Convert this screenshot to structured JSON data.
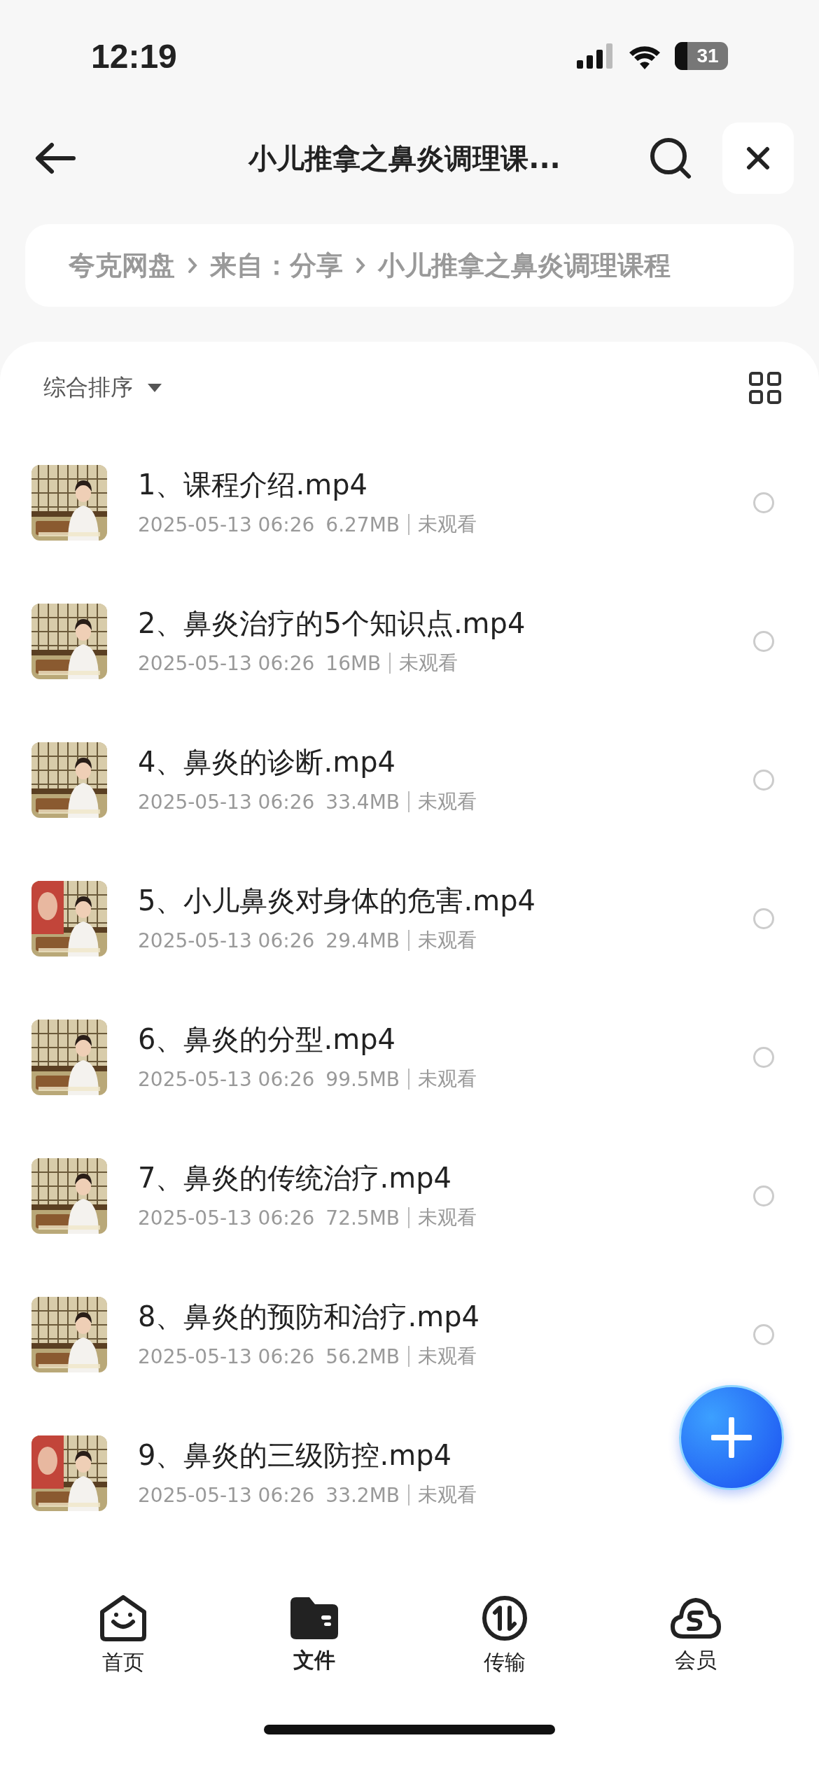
{
  "status_bar": {
    "time": "12:19",
    "battery": "31"
  },
  "header": {
    "title": "小儿推拿之鼻炎调理课..."
  },
  "breadcrumb": [
    "夸克网盘",
    "来自：分享",
    "小儿推拿之鼻炎调理课程"
  ],
  "sort": {
    "label": "综合排序"
  },
  "files": [
    {
      "name": "1、课程介绍.mp4",
      "date": "2025-05-13 06:26",
      "size": "6.27MB",
      "watch": "未观看",
      "selected": false
    },
    {
      "name": "2、鼻炎治疗的5个知识点.mp4",
      "date": "2025-05-13 06:26",
      "size": "16MB",
      "watch": "未观看",
      "selected": false
    },
    {
      "name": "4、鼻炎的诊断.mp4",
      "date": "2025-05-13 06:26",
      "size": "33.4MB",
      "watch": "未观看",
      "selected": false
    },
    {
      "name": "5、小儿鼻炎对身体的危害.mp4",
      "date": "2025-05-13 06:26",
      "size": "29.4MB",
      "watch": "未观看",
      "selected": false
    },
    {
      "name": "6、鼻炎的分型.mp4",
      "date": "2025-05-13 06:26",
      "size": "99.5MB",
      "watch": "未观看",
      "selected": false
    },
    {
      "name": "7、鼻炎的传统治疗.mp4",
      "date": "2025-05-13 06:26",
      "size": "72.5MB",
      "watch": "未观看",
      "selected": false
    },
    {
      "name": "8、鼻炎的预防和治疗.mp4",
      "date": "2025-05-13 06:26",
      "size": "56.2MB",
      "watch": "未观看",
      "selected": false
    },
    {
      "name": "9、鼻炎的三级防控.mp4",
      "date": "2025-05-13 06:26",
      "size": "33.2MB",
      "watch": "未观看"
    }
  ],
  "tabs": [
    {
      "label": "首页",
      "kind": "home",
      "selected": false
    },
    {
      "label": "文件",
      "kind": "files",
      "selected": true
    },
    {
      "label": "传输",
      "kind": "transfer",
      "selected": false
    },
    {
      "label": "会员",
      "kind": "member",
      "selected": false
    }
  ]
}
